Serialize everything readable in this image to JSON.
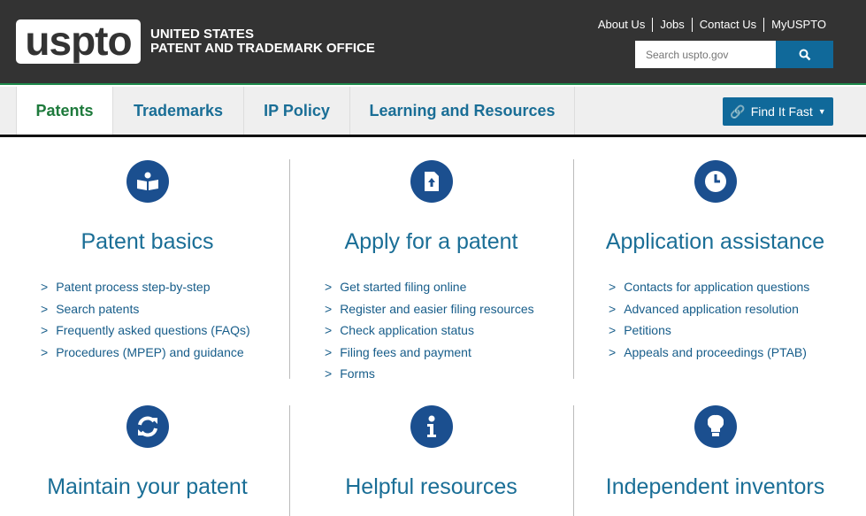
{
  "header": {
    "logo": "uspto",
    "agency_line1": "UNITED STATES",
    "agency_line2": "PATENT AND TRADEMARK OFFICE",
    "utility_links": [
      "About Us",
      "Jobs",
      "Contact Us",
      "MyUSPTO"
    ],
    "search_placeholder": "Search uspto.gov"
  },
  "nav": {
    "tabs": [
      "Patents",
      "Trademarks",
      "IP Policy",
      "Learning and Resources"
    ],
    "active": "Patents",
    "find_it_fast": "Find It Fast"
  },
  "sections": [
    {
      "title": "Patent basics",
      "icon": "book-icon",
      "links": [
        "Patent process step-by-step",
        "Search patents",
        "Frequently asked questions (FAQs)",
        "Procedures (MPEP) and guidance"
      ]
    },
    {
      "title": "Apply for a patent",
      "icon": "file-upload-icon",
      "links": [
        "Get started filing online",
        "Register and easier filing resources",
        "Check application status",
        "Filing fees and payment",
        "Forms"
      ]
    },
    {
      "title": "Application assistance",
      "icon": "clock-icon",
      "links": [
        "Contacts for application questions",
        "Advanced application resolution",
        "Petitions",
        "Appeals and proceedings (PTAB)"
      ]
    },
    {
      "title": "Maintain your patent",
      "icon": "refresh-icon",
      "links": []
    },
    {
      "title": "Helpful resources",
      "icon": "info-icon",
      "links": []
    },
    {
      "title": "Independent inventors",
      "icon": "lightbulb-icon",
      "links": []
    }
  ]
}
